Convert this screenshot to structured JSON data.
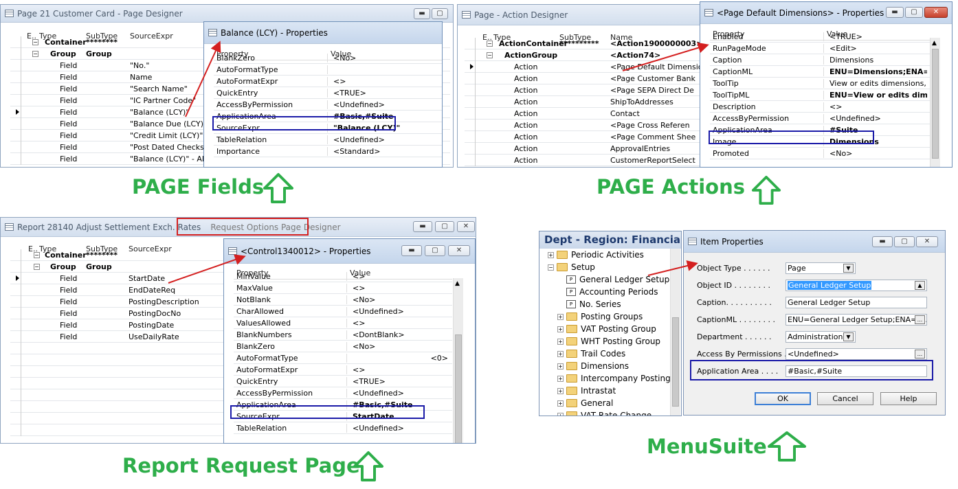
{
  "captions": {
    "page_fields": "PAGE Fields",
    "page_actions": "PAGE Actions",
    "report_request_page": "Report Request Page",
    "menusuite": "MenuSuite"
  },
  "page_designer": {
    "title": "Page 21 Customer Card - Page Designer",
    "headers": [
      "E..",
      "Type",
      "SubType",
      "SourceExpr"
    ],
    "rows": [
      {
        "e": "⊟",
        "type": "Container",
        "subtype": "********",
        "source": "",
        "bold": true
      },
      {
        "e": "⊟",
        "type": "Group",
        "subtype": "Group",
        "source": "",
        "bold": true
      },
      {
        "e": "",
        "type": "Field",
        "subtype": "",
        "source": "\"No.\""
      },
      {
        "e": "",
        "type": "Field",
        "subtype": "",
        "source": "Name"
      },
      {
        "e": "",
        "type": "Field",
        "subtype": "",
        "source": "\"Search Name\""
      },
      {
        "e": "",
        "type": "Field",
        "subtype": "",
        "source": "\"IC Partner Code\""
      },
      {
        "e": "",
        "type": "Field",
        "subtype": "",
        "source": "\"Balance (LCY)\""
      },
      {
        "e": "",
        "type": "Field",
        "subtype": "",
        "source": "\"Balance Due (LCY)\""
      },
      {
        "e": "",
        "type": "Field",
        "subtype": "",
        "source": "\"Credit Limit (LCY)\""
      },
      {
        "e": "",
        "type": "Field",
        "subtype": "",
        "source": "\"Post Dated Checks (L"
      },
      {
        "e": "",
        "type": "Field",
        "subtype": "",
        "source": "\"Balance (LCY)\" - ABS("
      }
    ]
  },
  "balance_props": {
    "title": "Balance (LCY) - Properties",
    "headers": [
      "Property",
      "Value"
    ],
    "rows": [
      {
        "p": "BlankZero",
        "v": "<No>"
      },
      {
        "p": "AutoFormatType",
        "v": ""
      },
      {
        "p": "AutoFormatExpr",
        "v": "<>"
      },
      {
        "p": "QuickEntry",
        "v": "<TRUE>"
      },
      {
        "p": "AccessByPermission",
        "v": "<Undefined>"
      },
      {
        "p": "ApplicationArea",
        "v": "#Basic,#Suite",
        "bold": true
      },
      {
        "p": "SourceExpr",
        "v": "\"Balance (LCY)\"",
        "bold": true
      },
      {
        "p": "TableRelation",
        "v": "<Undefined>"
      },
      {
        "p": "Importance",
        "v": "<Standard>"
      }
    ]
  },
  "action_designer": {
    "title": "Page - Action Designer",
    "headers": [
      "E..",
      "Type",
      "SubType",
      "Name"
    ],
    "rows": [
      {
        "type": "ActionContainer",
        "subtype": "**********",
        "name": "<Action1900000003>",
        "bold": true
      },
      {
        "type": "ActionGroup",
        "subtype": "",
        "name": "<Action74>",
        "bold": true
      },
      {
        "type": "Action",
        "subtype": "",
        "name": "<Page Default Dimensions>"
      },
      {
        "type": "Action",
        "subtype": "",
        "name": "<Page Customer Bank"
      },
      {
        "type": "Action",
        "subtype": "",
        "name": "<Page SEPA Direct De"
      },
      {
        "type": "Action",
        "subtype": "",
        "name": "ShipToAddresses"
      },
      {
        "type": "Action",
        "subtype": "",
        "name": "Contact"
      },
      {
        "type": "Action",
        "subtype": "",
        "name": "<Page Cross Referen"
      },
      {
        "type": "Action",
        "subtype": "",
        "name": "<Page Comment Shee"
      },
      {
        "type": "Action",
        "subtype": "",
        "name": "ApprovalEntries"
      },
      {
        "type": "Action",
        "subtype": "",
        "name": "CustomerReportSelect"
      }
    ]
  },
  "dims_props": {
    "title": "<Page Default Dimensions> - Properties",
    "headers": [
      "Property",
      "Value"
    ],
    "rows": [
      {
        "p": "Enabled",
        "v": "<TRUE>"
      },
      {
        "p": "RunPageMode",
        "v": "<Edit>"
      },
      {
        "p": "Caption",
        "v": "Dimensions"
      },
      {
        "p": "CaptionML",
        "v": "ENU=Dimensions;ENA=...",
        "bold": true
      },
      {
        "p": "ToolTip",
        "v": "View or edits dimensions, s..."
      },
      {
        "p": "ToolTipML",
        "v": "ENU=View or edits dime...",
        "bold": true
      },
      {
        "p": "Description",
        "v": "<>"
      },
      {
        "p": "AccessByPermission",
        "v": "<Undefined>"
      },
      {
        "p": "ApplicationArea",
        "v": "#Suite",
        "bold": true
      },
      {
        "p": "Image",
        "v": "Dimensions",
        "bold": true
      },
      {
        "p": "Promoted",
        "v": "<No>"
      }
    ]
  },
  "report_designer": {
    "title": "Report 28140 Adjust Settlement Exch. Rates",
    "title_highlight": "Request Options Page Designer",
    "headers": [
      "E..",
      "Type",
      "SubType",
      "SourceExpr"
    ],
    "rows": [
      {
        "type": "Container",
        "subtype": "********",
        "source": "",
        "bold": true
      },
      {
        "type": "Group",
        "subtype": "Group",
        "source": "",
        "bold": true
      },
      {
        "type": "Field",
        "subtype": "",
        "source": "StartDate"
      },
      {
        "type": "Field",
        "subtype": "",
        "source": "EndDateReq"
      },
      {
        "type": "Field",
        "subtype": "",
        "source": "PostingDescription"
      },
      {
        "type": "Field",
        "subtype": "",
        "source": "PostingDocNo"
      },
      {
        "type": "Field",
        "subtype": "",
        "source": "PostingDate"
      },
      {
        "type": "Field",
        "subtype": "",
        "source": "UseDailyRate"
      }
    ]
  },
  "control_props": {
    "title": "<Control1340012> - Properties",
    "headers": [
      "Property",
      "Value"
    ],
    "rows": [
      {
        "p": "MinValue",
        "v": "<>"
      },
      {
        "p": "MaxValue",
        "v": "<>"
      },
      {
        "p": "NotBlank",
        "v": "<No>"
      },
      {
        "p": "CharAllowed",
        "v": "<Undefined>"
      },
      {
        "p": "ValuesAllowed",
        "v": "<>"
      },
      {
        "p": "BlankNumbers",
        "v": "<DontBlank>"
      },
      {
        "p": "BlankZero",
        "v": "<No>"
      },
      {
        "p": "AutoFormatType",
        "v": "<0>",
        "right": true
      },
      {
        "p": "AutoFormatExpr",
        "v": "<>"
      },
      {
        "p": "QuickEntry",
        "v": "<TRUE>"
      },
      {
        "p": "AccessByPermission",
        "v": "<Undefined>"
      },
      {
        "p": "ApplicationArea",
        "v": "#Basic,#Suite",
        "bold": true
      },
      {
        "p": "SourceExpr",
        "v": "StartDate",
        "bold": true
      },
      {
        "p": "TableRelation",
        "v": "<Undefined>"
      }
    ]
  },
  "menusuite": {
    "title": "Dept - Region: Financia...",
    "items": [
      {
        "label": "Periodic Activities",
        "kind": "folder",
        "indent": 0,
        "exp": "+"
      },
      {
        "label": "Setup",
        "kind": "folder",
        "indent": 0,
        "exp": "-"
      },
      {
        "label": "General Ledger Setup",
        "kind": "page",
        "indent": 1,
        "exp": ""
      },
      {
        "label": "Accounting Periods",
        "kind": "page",
        "indent": 1,
        "exp": ""
      },
      {
        "label": "No. Series",
        "kind": "page",
        "indent": 1,
        "exp": ""
      },
      {
        "label": "Posting Groups",
        "kind": "folder",
        "indent": 1,
        "exp": "+"
      },
      {
        "label": "VAT Posting Group",
        "kind": "folder",
        "indent": 1,
        "exp": "+"
      },
      {
        "label": "WHT Posting Group",
        "kind": "folder",
        "indent": 1,
        "exp": "+"
      },
      {
        "label": "Trail Codes",
        "kind": "folder",
        "indent": 1,
        "exp": "+"
      },
      {
        "label": "Dimensions",
        "kind": "folder",
        "indent": 1,
        "exp": "+"
      },
      {
        "label": "Intercompany Postings",
        "kind": "folder",
        "indent": 1,
        "exp": "+"
      },
      {
        "label": "Intrastat",
        "kind": "folder",
        "indent": 1,
        "exp": "+"
      },
      {
        "label": "General",
        "kind": "folder",
        "indent": 1,
        "exp": "+"
      },
      {
        "label": "VAT Rate Change",
        "kind": "folder",
        "indent": 1,
        "exp": "+"
      }
    ]
  },
  "item_props": {
    "title": "Item Properties",
    "fields": [
      {
        "label": "Object Type  . . . . . .",
        "value": "Page",
        "ctrl": "dropdown"
      },
      {
        "label": "Object ID . . . . . . . .",
        "value": "General Ledger Setup",
        "ctrl": "lookup",
        "selected": true
      },
      {
        "label": "Caption. . . . . . . . . .",
        "value": "General Ledger Setup",
        "ctrl": ""
      },
      {
        "label": "CaptionML . . . . . . . .",
        "value": "ENU=General Ledger Setup;ENA=G...",
        "ctrl": "assist"
      },
      {
        "label": "Department . . . . . .",
        "value": "Administration",
        "ctrl": "dropdown"
      },
      {
        "label": "Access By Permissions  .",
        "value": "<Undefined>",
        "ctrl": "assist"
      },
      {
        "label": "Application Area  . . . .",
        "value": "#Basic,#Suite",
        "ctrl": ""
      }
    ],
    "ok": "OK",
    "cancel": "Cancel",
    "help": "Help"
  },
  "icons": {
    "arrow": "outline-up-arrow-icon",
    "row_selector": "triangle-right-icon"
  },
  "colors": {
    "caption_green": "#2eae4a",
    "highlight_blue": "#1a1aa8",
    "arrow_red": "#d42020"
  }
}
